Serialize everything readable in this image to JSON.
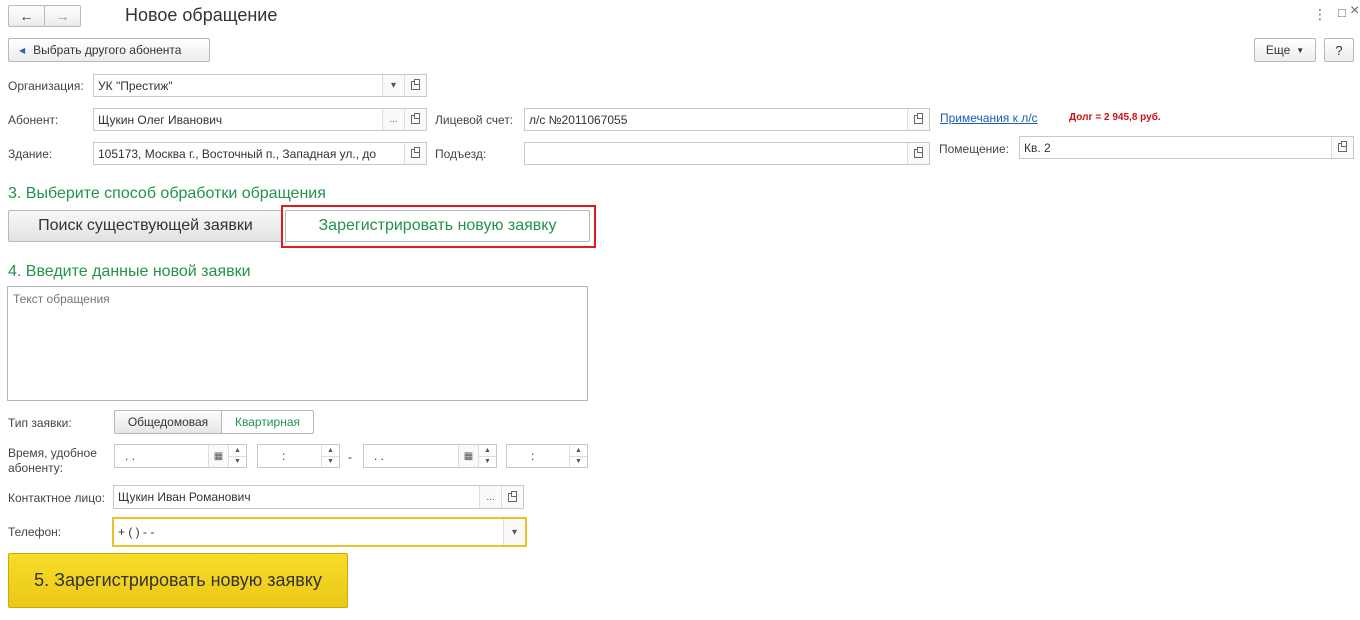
{
  "window": {
    "title": "Новое обращение",
    "back_icon": "←",
    "forward_icon": "→",
    "menu_icon": "⋮",
    "minimize_icon": "□",
    "close_icon": "×"
  },
  "toolbar": {
    "choose_subscriber_label": "Выбрать другого абонента",
    "more_label": "Еще",
    "help_label": "?"
  },
  "form": {
    "organization_label": "Организация:",
    "organization_value": "УК \"Престиж\"",
    "subscriber_label": "Абонент:",
    "subscriber_value": "Щукин Олег Иванович",
    "account_label": "Лицевой счет:",
    "account_value": "л/с №2011067055",
    "notes_link": "Примечания к л/с",
    "debt_text": "Долг = 2 945,8 руб.",
    "building_label": "Здание:",
    "building_value": "105173, Москва г., Восточный п., Западная ул., до",
    "entrance_label": "Подъезд:",
    "entrance_value": "",
    "room_label": "Помещение:",
    "room_value": "Кв. 2"
  },
  "step3": {
    "title": "3. Выберите способ обработки обращения",
    "search_label": "Поиск существующей заявки",
    "register_label": "Зарегистрировать новую заявку"
  },
  "step4": {
    "title": "4. Введите данные новой заявки",
    "text_placeholder": "Текст обращения",
    "type_label": "Тип заявки:",
    "type_options": [
      "Общедомовая",
      "Квартирная"
    ],
    "type_selected": "Квартирная",
    "time_label_line1": "Время, удобное",
    "time_label_line2": "абоненту:",
    "date_from": " .  .",
    "time_from": " :",
    "dash": "-",
    "date_to": " .  .",
    "time_to": " :",
    "contact_label": "Контактное лицо:",
    "contact_value": "Щукин Иван Романович",
    "phone_label": "Телефон:",
    "phone_value": "+ (   )   -  -"
  },
  "step5": {
    "submit_label": "5. Зарегистрировать новую заявку"
  },
  "colors": {
    "accent_green": "#22934a",
    "highlight_red": "#e01b1b",
    "link_blue": "#1a5fb4",
    "debt_red": "#d01010",
    "submit_yellow": "#f2d01a",
    "phone_border": "#e8c22a"
  }
}
